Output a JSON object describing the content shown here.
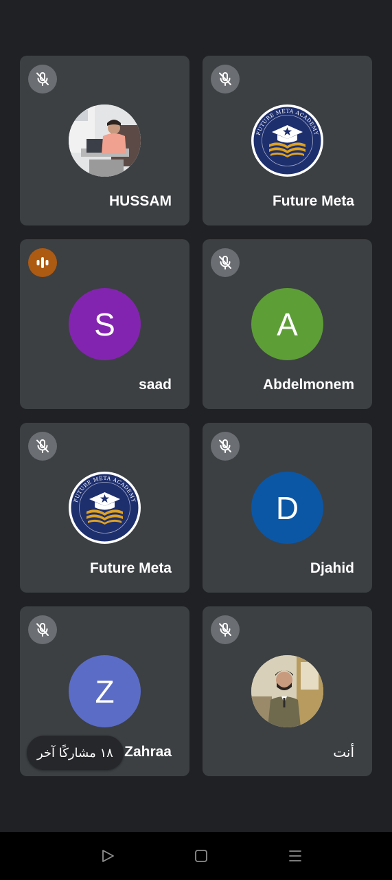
{
  "participants": [
    {
      "name": "HUSSAM",
      "mic": "muted",
      "avatar_type": "photo-man-desk"
    },
    {
      "name": "Future Meta",
      "mic": "muted",
      "avatar_type": "logo-future-meta-academy"
    },
    {
      "name": "saad",
      "mic": "speaking",
      "avatar_type": "letter",
      "initial": "S",
      "avatar_color": "#8324b0"
    },
    {
      "name": "Abdelmonem",
      "mic": "muted",
      "avatar_type": "letter",
      "initial": "A",
      "avatar_color": "#5d9e36"
    },
    {
      "name": "Future Meta",
      "mic": "muted",
      "avatar_type": "logo-future-meta-academy"
    },
    {
      "name": "Djahid",
      "mic": "muted",
      "avatar_type": "letter",
      "initial": "D",
      "avatar_color": "#0b57a6"
    },
    {
      "name": "Zahraa",
      "mic": "muted",
      "avatar_type": "letter",
      "initial": "Z",
      "avatar_color": "#5b6cc7"
    },
    {
      "name": "أنت",
      "mic": "muted",
      "avatar_type": "photo-man-suit"
    }
  ],
  "others_chip": {
    "label": "١٨ مشاركًا آخر"
  },
  "logo_text": "FUTURE META ACADEMY",
  "colors": {
    "background": "#202124",
    "tile": "#3c4043",
    "mic_muted": "#6b6e72",
    "mic_speaking": "#ad5a12",
    "logo_navy": "#1e2f6e",
    "logo_gold": "#e0a21e"
  },
  "nav": {
    "icons": [
      "back-triangle-icon",
      "home-square-icon",
      "recents-lines-icon"
    ]
  }
}
